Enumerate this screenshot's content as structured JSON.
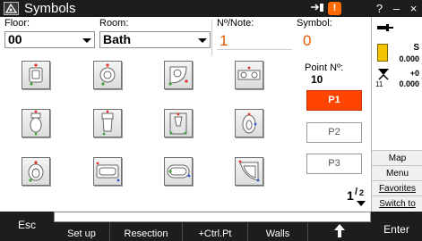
{
  "window": {
    "title": "Symbols",
    "warning_glyph": "!",
    "help_label": "?",
    "minimize_label": "–",
    "close_label": "×"
  },
  "form": {
    "floor_label": "Floor:",
    "floor_value": "00",
    "room_label": "Room:",
    "room_value": "Bath",
    "note_label": "Nº/Note:",
    "note_value": "1",
    "symbol_label": "Symbol:",
    "symbol_value": "0",
    "point_label": "Point Nº:",
    "point_value": "10"
  },
  "symbols": [
    {
      "name": "washbasin-square-icon"
    },
    {
      "name": "washbasin-round-icon"
    },
    {
      "name": "corner-basin-icon"
    },
    {
      "name": "double-basin-icon"
    },
    {
      "name": "toilet-icon"
    },
    {
      "name": "toilet-cistern-icon"
    },
    {
      "name": "urinal-icon"
    },
    {
      "name": "bidet-icon"
    },
    {
      "name": "toilet-round-icon"
    },
    {
      "name": "bathtub-icon"
    },
    {
      "name": "oval-bathtub-icon"
    },
    {
      "name": "corner-shower-icon"
    }
  ],
  "point_buttons": [
    "P1",
    "P2",
    "P3"
  ],
  "pager": {
    "current": "1",
    "total": "2"
  },
  "status": {
    "battery_label": "S",
    "battery_value": "0.000",
    "compensator_label": "+0",
    "compensator_value": "0.000",
    "compensator_sub": "11"
  },
  "side_buttons": [
    "Map",
    "Menu",
    "Favorites",
    "Switch to"
  ],
  "bottom": {
    "esc": "Esc",
    "keys": [
      "Set up",
      "Resection",
      "+Ctrl.Pt",
      "Walls"
    ],
    "enter": "Enter"
  },
  "colors": {
    "accent": "#ff4500",
    "titlebar": "#1d1d1d",
    "value_orange": "#e05a00"
  }
}
